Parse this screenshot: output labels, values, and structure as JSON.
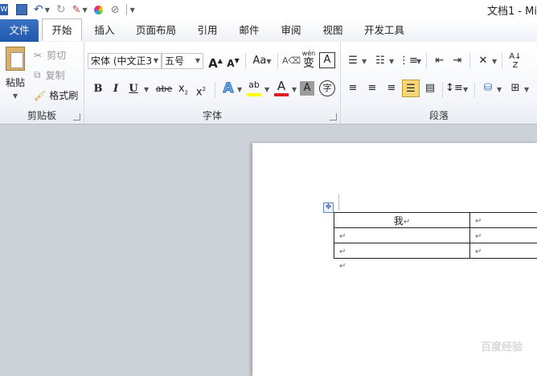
{
  "window": {
    "title": "文档1 - Mi"
  },
  "quick_access": {
    "word_icon": "word-icon",
    "save": "save-icon",
    "undo": "undo-icon",
    "redo": "redo-icon"
  },
  "tabs": [
    "文件",
    "开始",
    "插入",
    "页面布局",
    "引用",
    "邮件",
    "审阅",
    "视图",
    "开发工具"
  ],
  "active_tab": "开始",
  "clipboard": {
    "label": "剪贴板",
    "paste": "粘贴",
    "cut": "剪切",
    "copy": "复制",
    "format_painter": "格式刷"
  },
  "font": {
    "label": "字体",
    "font_name": "宋体 (中文正3",
    "font_size": "五号",
    "grow": "A",
    "shrink": "A",
    "change_case": "Aa",
    "pinyin_glyph": "wén",
    "pinyin_char": "变",
    "border_char": "A",
    "bold": "B",
    "italic": "I",
    "underline": "U",
    "strike": "abe",
    "subscript": "x",
    "superscript": "x",
    "highlight": "ab",
    "font_color": "A",
    "shading": "A",
    "enclose": "字"
  },
  "paragraph": {
    "label": "段落"
  },
  "document": {
    "table": [
      [
        "我",
        ""
      ],
      [
        "",
        ""
      ],
      [
        "",
        ""
      ]
    ],
    "paragraph_mark": "↵",
    "move_handle_icon": "move-icon"
  },
  "watermark": "百度经验",
  "colors": {
    "file_tab": "#2a65bb",
    "highlight": "#ffff00",
    "font_color": "#e02020",
    "align_active": "#f7d676"
  }
}
